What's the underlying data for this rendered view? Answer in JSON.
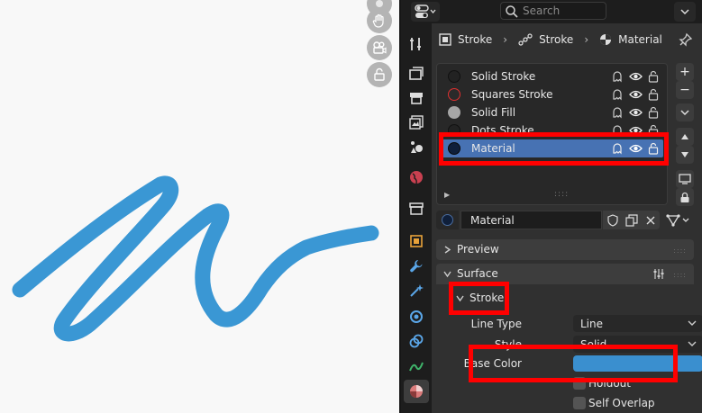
{
  "header": {
    "search_placeholder": "Search"
  },
  "breadcrumb": {
    "items": [
      {
        "label": "Stroke",
        "icon": "object-icon"
      },
      {
        "label": "Stroke",
        "icon": "grease-pencil-data-icon"
      },
      {
        "label": "Material",
        "icon": "material-icon"
      }
    ]
  },
  "material_slots": [
    {
      "name": "Solid Stroke",
      "ball": "stroke-dark",
      "active": false
    },
    {
      "name": "Squares Stroke",
      "ball": "stroke-red",
      "active": false
    },
    {
      "name": "Solid Fill",
      "ball": "fill-grey",
      "active": false
    },
    {
      "name": "Dots Stroke",
      "ball": "stroke-dark",
      "active": false
    },
    {
      "name": "Material",
      "ball": "stroke-blue",
      "active": true
    }
  ],
  "material_selector": {
    "value": "Material"
  },
  "panels": {
    "preview": "Preview",
    "surface": "Surface",
    "stroke": "Stroke"
  },
  "stroke": {
    "line_type_label": "Line Type",
    "line_type_value": "Line",
    "style_label": "Style",
    "style_value": "Solid",
    "base_color_label": "Base Color",
    "base_color": "#3a8fcf",
    "holdout_label": "Holdout",
    "self_overlap_label": "Self Overlap"
  },
  "colors": {
    "stroke_drawing": "#3a97d4",
    "active_highlight": "#4772b3",
    "annotation": "#ff0000"
  }
}
